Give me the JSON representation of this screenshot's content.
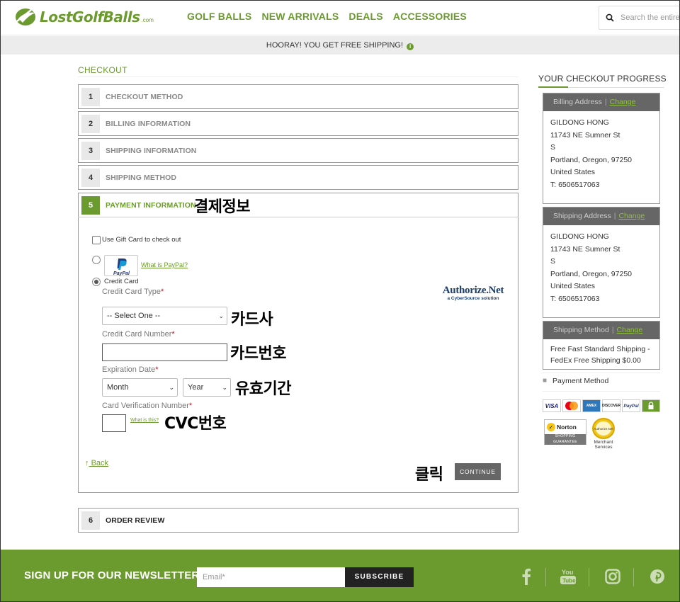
{
  "header": {
    "logo_text": "LostGolfBalls",
    "logo_suffix": ".com",
    "nav": [
      "GOLF BALLS",
      "NEW ARRIVALS",
      "DEALS",
      "ACCESSORIES"
    ],
    "search_placeholder": "Search the entire store"
  },
  "promo": {
    "text": "HOORAY! YOU GET FREE SHIPPING!"
  },
  "checkout": {
    "title": "CHECKOUT",
    "steps": [
      {
        "num": "1",
        "label": "CHECKOUT METHOD"
      },
      {
        "num": "2",
        "label": "BILLING INFORMATION"
      },
      {
        "num": "3",
        "label": "SHIPPING INFORMATION"
      },
      {
        "num": "4",
        "label": "SHIPPING METHOD"
      },
      {
        "num": "5",
        "label": "PAYMENT INFORMATION"
      },
      {
        "num": "6",
        "label": "ORDER REVIEW"
      }
    ],
    "payment": {
      "gift_card_label": "Use Gift Card to check out",
      "paypal_logo_text": "PayPal",
      "paypal_link": "What is PayPal?",
      "credit_card_label": "Credit Card",
      "card_type_label": "Credit Card Type",
      "card_type_value": "-- Select One --",
      "card_number_label": "Credit Card Number",
      "card_number_value": "",
      "expiration_label": "Expiration Date",
      "month_value": "Month",
      "year_value": "Year",
      "cvv_label": "Card Verification Number",
      "cvv_link": "What is this?",
      "required_mark": "*",
      "authorize_net": "Authorize.Net",
      "authorize_net_sub": "a CyberSource solution",
      "back_label": "Back",
      "continue_label": "CONTINUE"
    },
    "annotations": {
      "payment_info": "결제정보",
      "card_company": "카드사",
      "card_number": "카드번호",
      "expiry": "유효기간",
      "cvc": "CVC번호",
      "click": "클릭"
    }
  },
  "sidebar": {
    "title": "YOUR CHECKOUT PROGRESS",
    "change_label": "Change",
    "billing": {
      "heading": "Billing Address",
      "lines": [
        "GILDONG HONG",
        "11743 NE Sumner St",
        "S",
        "Portland, Oregon, 97250",
        "United States",
        "T: 6506517063"
      ]
    },
    "shipping": {
      "heading": "Shipping Address",
      "lines": [
        "GILDONG HONG",
        "11743 NE Sumner St",
        "S",
        "Portland, Oregon, 97250",
        "United States",
        "T: 6506517063"
      ]
    },
    "shipping_method": {
      "heading": "Shipping Method",
      "lines": [
        "Free Fast Standard Shipping -",
        "FedEx Free Shipping $0.00"
      ]
    },
    "payment_method": "Payment Method",
    "card_logos": [
      "VISA",
      "MC",
      "AMEX",
      "DISCOVER",
      "PayPal",
      "lock"
    ],
    "norton_text": "Norton",
    "norton_sub": "SHOPPING GUARANTEE",
    "anet_seal_text": "Authorize.Net",
    "anet_caption": "Merchant Services"
  },
  "footer": {
    "newsletter_title": "SIGN UP FOR OUR NEWSLETTER",
    "email_placeholder": "Email*",
    "subscribe_label": "SUBSCRIBE",
    "social": [
      "facebook-icon",
      "youtube-icon",
      "instagram-icon",
      "pinterest-icon"
    ]
  },
  "colors": {
    "brand_green": "#6b9a2e",
    "dark_gray": "#666666"
  }
}
